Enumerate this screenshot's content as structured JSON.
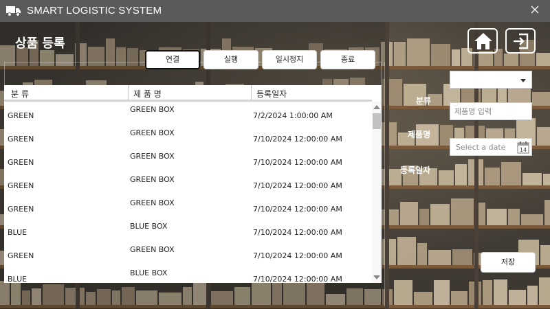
{
  "window": {
    "title": "SMART LOGISTIC SYSTEM",
    "close_glyph": "✕",
    "icons": {
      "app": "truck-icon",
      "close": "close-icon"
    }
  },
  "header": {
    "page_title": "상품 등록",
    "icons": {
      "home": "home-icon",
      "logout": "exit-icon"
    }
  },
  "toolbar": {
    "buttons": [
      "연결",
      "실행",
      "일시정지",
      "종료"
    ]
  },
  "grid": {
    "columns": [
      "분 류",
      "제 품 명",
      "등록일자"
    ],
    "rows": [
      [
        "GREEN",
        "GREEN BOX",
        "7/2/2024 1:00:00 AM"
      ],
      [
        "GREEN",
        "GREEN BOX",
        "7/10/2024 12:00:00 AM"
      ],
      [
        "GREEN",
        "GREEN BOX",
        "7/10/2024 12:00:00 AM"
      ],
      [
        "GREEN",
        "GREEN BOX",
        "7/10/2024 12:00:00 AM"
      ],
      [
        "GREEN",
        "GREEN BOX",
        "7/10/2024 12:00:00 AM"
      ],
      [
        "BLUE",
        "BLUE BOX",
        "7/10/2024 12:00:00 AM"
      ],
      [
        "GREEN",
        "GREEN BOX",
        "7/10/2024 12:00:00 AM"
      ],
      [
        "BLUE",
        "BLUE BOX",
        "7/10/2024 12:00:00 AM"
      ]
    ]
  },
  "form": {
    "category_label": "분류",
    "category_value": "",
    "product_label": "제품명",
    "product_placeholder": "제품명 입력",
    "date_label": "등록일자",
    "date_placeholder": "Select a date",
    "calendar_day": "14",
    "save_label": "저장"
  },
  "colors": {
    "titlebar": "#5a5a5a",
    "text_light": "#ffffff"
  }
}
